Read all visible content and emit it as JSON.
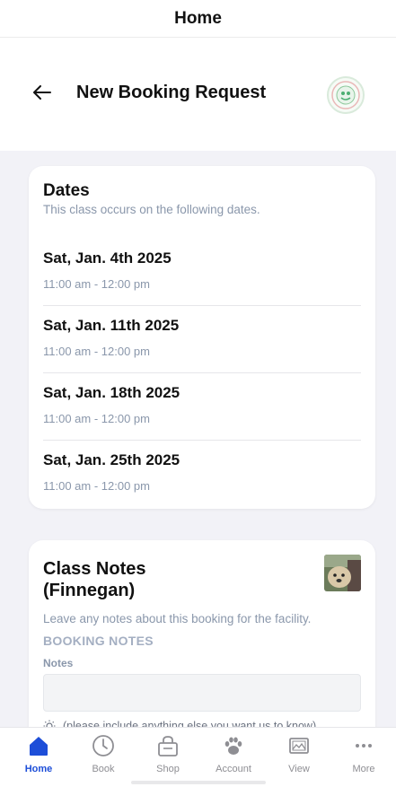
{
  "topbar": {
    "title": "Home"
  },
  "header": {
    "title": "New Booking Request",
    "logo_icon": "facility-logo-icon",
    "back_icon": "back-arrow-icon"
  },
  "dates": {
    "title": "Dates",
    "subtitle": "This class occurs on the following dates.",
    "items": [
      {
        "date": "Sat, Jan. 4th 2025",
        "time": "11:00 am - 12:00 pm"
      },
      {
        "date": "Sat, Jan. 11th 2025",
        "time": "11:00 am - 12:00 pm"
      },
      {
        "date": "Sat, Jan. 18th 2025",
        "time": "11:00 am - 12:00 pm"
      },
      {
        "date": "Sat, Jan. 25th 2025",
        "time": "11:00 am - 12:00 pm"
      }
    ]
  },
  "notes": {
    "title_line1": "Class Notes",
    "title_line2": "(Finnegan)",
    "description": "Leave any notes about this booking for the facility.",
    "section_label": "BOOKING NOTES",
    "field_label": "Notes",
    "input_value": "",
    "hint": "(please include anything else you want us to know)"
  },
  "tabbar": {
    "tabs": [
      {
        "label": "Home",
        "icon": "home-icon",
        "active": true
      },
      {
        "label": "Book",
        "icon": "clock-icon",
        "active": false
      },
      {
        "label": "Shop",
        "icon": "shop-bag-icon",
        "active": false
      },
      {
        "label": "Account",
        "icon": "paw-icon",
        "active": false
      },
      {
        "label": "View",
        "icon": "image-icon",
        "active": false
      },
      {
        "label": "More",
        "icon": "more-dots-icon",
        "active": false
      }
    ]
  },
  "colors": {
    "accent": "#1d4ed8",
    "muted": "#8a97ab",
    "background": "#f2f2f7"
  }
}
